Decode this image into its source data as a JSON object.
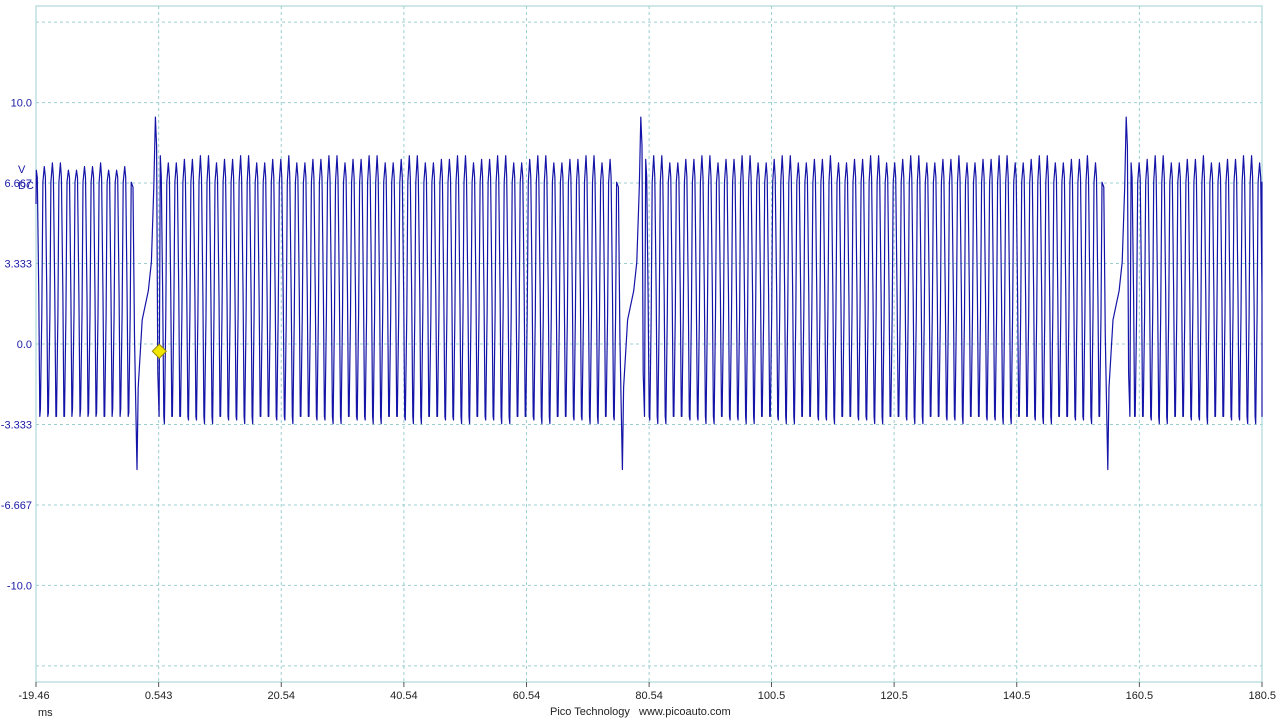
{
  "chart_data": {
    "type": "line",
    "title": "",
    "xlabel": "",
    "ylabel": "",
    "y_unit": "V",
    "y_coupling": "DC",
    "x_unit": "ms",
    "xlim": [
      -19.46,
      180.5
    ],
    "ylim": [
      -14.0,
      14.0
    ],
    "y_ticks": [
      10.0,
      6.667,
      3.333,
      0.0,
      -3.333,
      -6.667,
      -10.0
    ],
    "y_tick_labels": [
      "10.0",
      "6.667",
      "3.333",
      "0.0",
      "-3.333",
      "-6.667",
      "-10.0"
    ],
    "x_ticks": [
      -19.46,
      0.543,
      20.54,
      40.54,
      60.54,
      80.54,
      100.5,
      120.5,
      140.5,
      160.5,
      180.5
    ],
    "x_tick_labels": [
      "-19.46",
      "0.543",
      "20.54",
      "40.54",
      "60.54",
      "80.54",
      "100.5",
      "120.5",
      "140.5",
      "160.5",
      "180.5"
    ],
    "grid": true,
    "series": [
      {
        "color": "#1414a8",
        "high_v": 7.5,
        "low_v": -3.0,
        "period_ms": 1.31,
        "gap_start_ms": [
          -4.0,
          75.2,
          154.4
        ],
        "gap_negative_spike_v": -5.2,
        "gap_positive_spike_v": 9.4
      }
    ],
    "trigger": {
      "x": 0.0,
      "y": -0.3,
      "color": "#f2e600"
    }
  },
  "footer": {
    "brand": "Pico Technology",
    "website": "www.picoauto.com"
  }
}
